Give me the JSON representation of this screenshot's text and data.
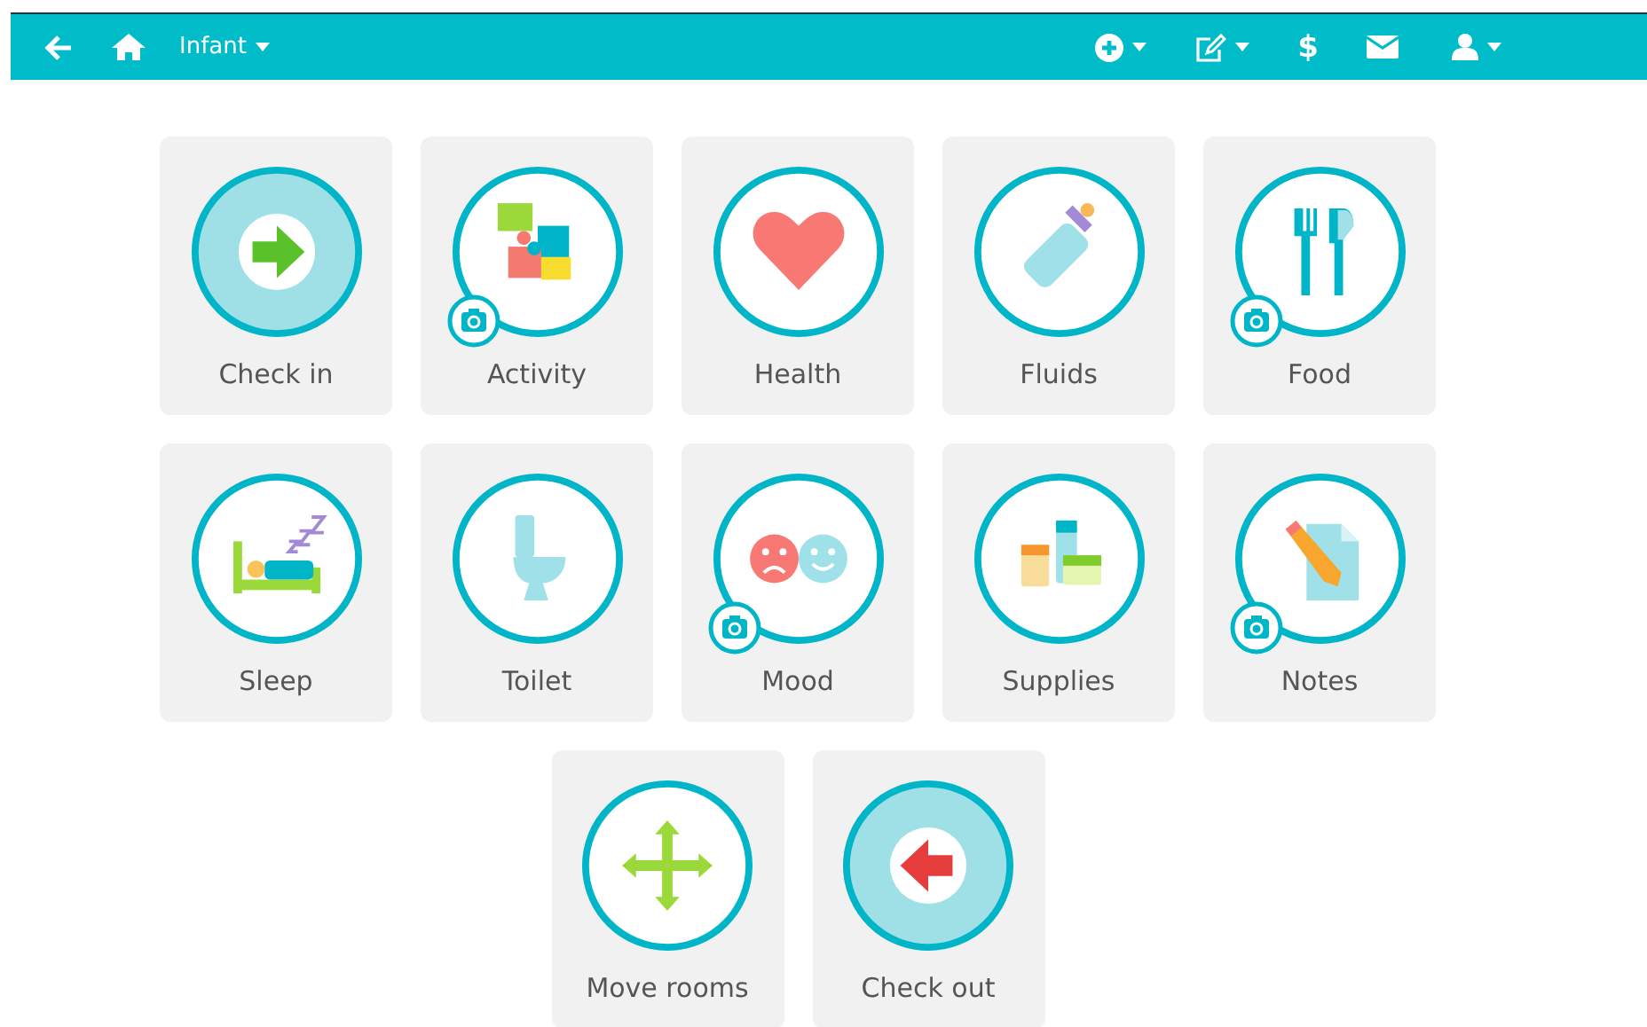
{
  "navbar": {
    "room": "Infant",
    "dollar": "$"
  },
  "tiles": [
    {
      "label": "Check in",
      "kind": "checkin",
      "highlighted": true,
      "camera": false
    },
    {
      "label": "Activity",
      "kind": "puzzle",
      "highlighted": false,
      "camera": true
    },
    {
      "label": "Health",
      "kind": "heart",
      "highlighted": false,
      "camera": false
    },
    {
      "label": "Fluids",
      "kind": "bottle",
      "highlighted": false,
      "camera": false
    },
    {
      "label": "Food",
      "kind": "cutlery",
      "highlighted": false,
      "camera": true
    },
    {
      "label": "Sleep",
      "kind": "bed",
      "highlighted": false,
      "camera": false
    },
    {
      "label": "Toilet",
      "kind": "toilet",
      "highlighted": false,
      "camera": false
    },
    {
      "label": "Mood",
      "kind": "faces",
      "highlighted": false,
      "camera": true
    },
    {
      "label": "Supplies",
      "kind": "jars",
      "highlighted": false,
      "camera": false
    },
    {
      "label": "Notes",
      "kind": "notes",
      "highlighted": false,
      "camera": true
    },
    {
      "label": "Move rooms",
      "kind": "move",
      "highlighted": false,
      "camera": false
    },
    {
      "label": "Check out",
      "kind": "checkout",
      "highlighted": true,
      "camera": false
    }
  ]
}
